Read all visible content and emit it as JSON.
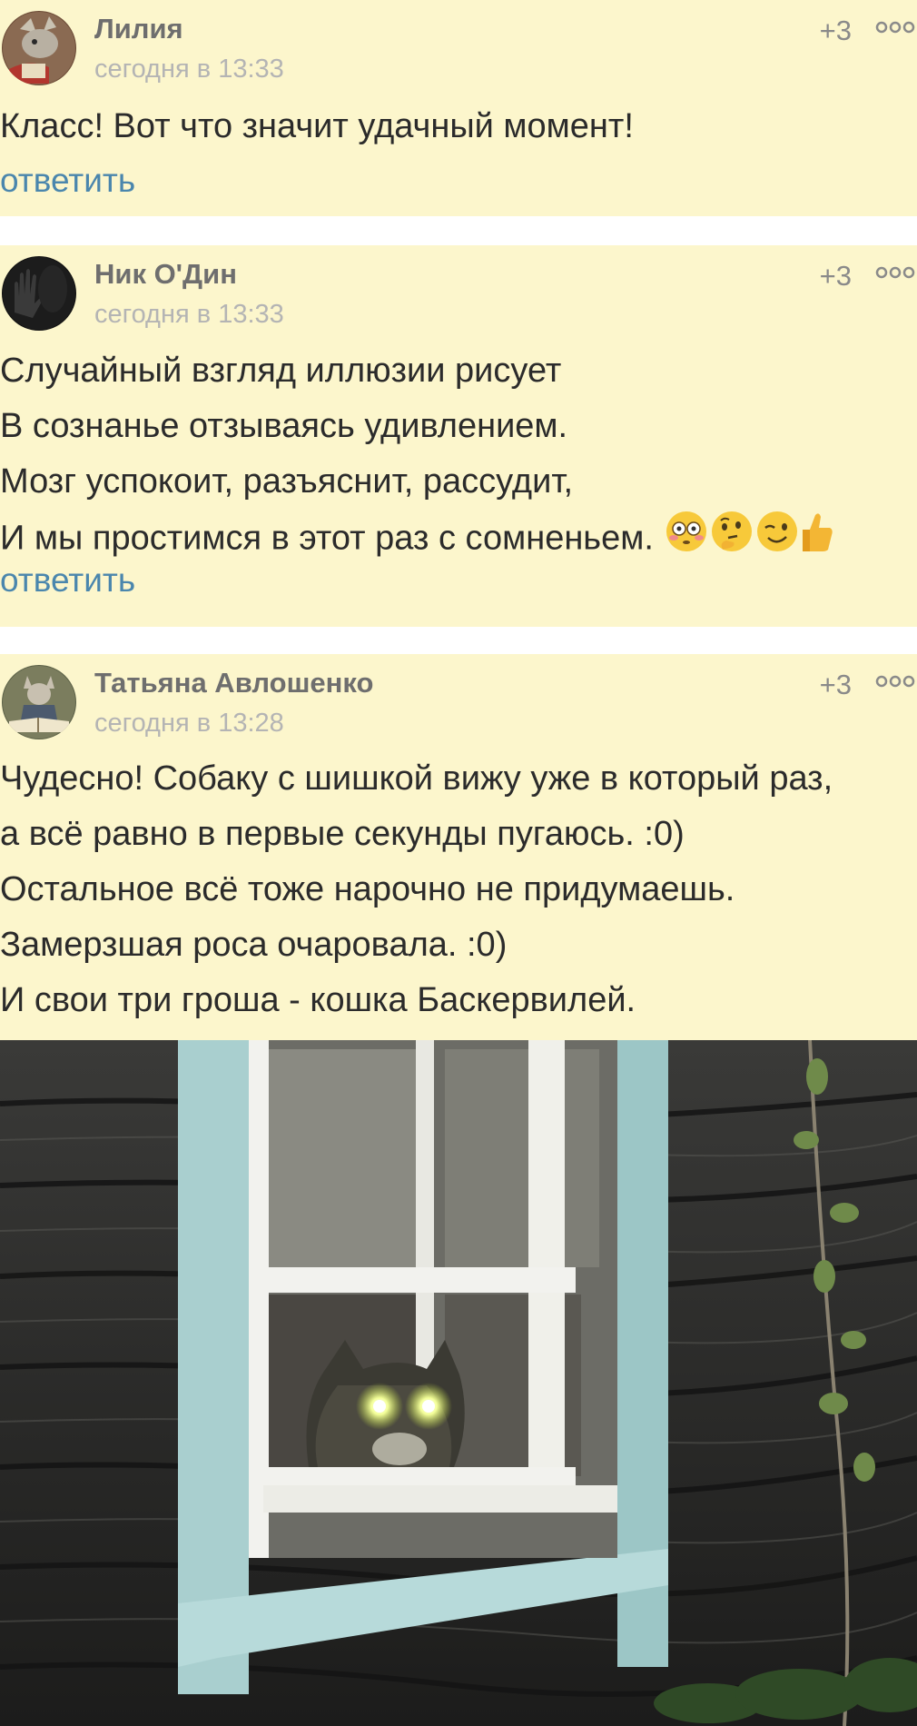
{
  "comments": [
    {
      "author": "Лилия",
      "time": "сегодня в 13:33",
      "rating": "+3",
      "text": [
        "Класс! Вот что значит удачный момент!"
      ],
      "reply_label": "ответить",
      "avatar_icon": "dragon-reading-avatar-icon"
    },
    {
      "author": "Ник О'Дин",
      "time": "сегодня в 13:33",
      "rating": "+3",
      "text": [
        "Случайный взгляд иллюзии рисует",
        "В сознанье отзываясь удивлением.",
        "Мозг успокоит, разъяснит, рассудит,",
        "И мы простимся в этот раз с сомненьем."
      ],
      "emojis": [
        "flushed-face-icon",
        "thinking-face-icon",
        "winking-face-icon",
        "thumbs-up-icon"
      ],
      "reply_label": "ответить",
      "avatar_icon": "dark-hand-avatar-icon"
    },
    {
      "author": "Татьяна Авлошенко",
      "time": "сегодня в 13:28",
      "rating": "+3",
      "text": [
        "Чудесно! Собаку с шишкой вижу уже в который раз,",
        "а всё равно в первые секунды пугаюсь. :0)",
        "Остальное всё тоже нарочно не придумаешь.",
        "Замерзшая роса очаровала. :0)",
        "И свои три гроша - кошка Баскервилей."
      ],
      "avatar_icon": "wolf-with-book-avatar-icon",
      "image": "cat-with-glowing-eyes-in-window-photo"
    }
  ],
  "colors": {
    "comment_bg": "#fcf6cc",
    "reply_link": "#4a86ad",
    "author": "#6e6e6e",
    "time": "#b4b4b4"
  }
}
